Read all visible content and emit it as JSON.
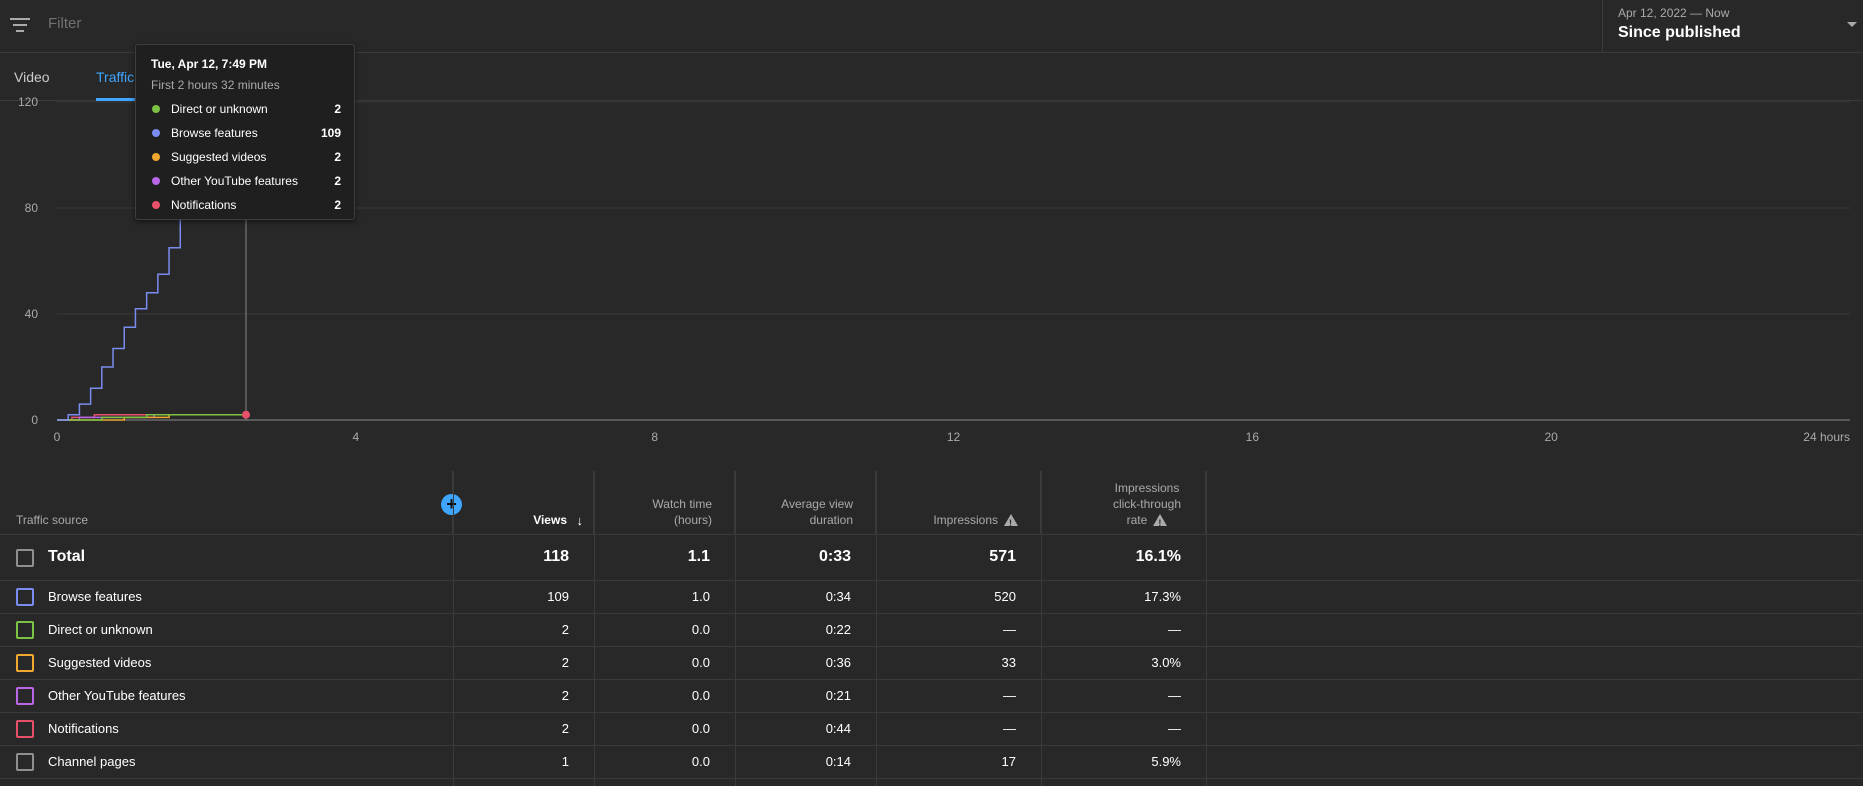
{
  "filter": {
    "placeholder": "Filter"
  },
  "date_picker": {
    "range": "Apr 12, 2022 — Now",
    "label": "Since published"
  },
  "tabs": [
    {
      "label": "Video",
      "active": false
    },
    {
      "label": "Traffic source",
      "active": true
    }
  ],
  "tooltip": {
    "title": "Tue, Apr 12, 7:49 PM",
    "subtitle": "First 2 hours 32 minutes",
    "rows": [
      {
        "label": "Direct or unknown",
        "value": "2",
        "color": "#7cc244"
      },
      {
        "label": "Browse features",
        "value": "109",
        "color": "#7a8cf0"
      },
      {
        "label": "Suggested videos",
        "value": "2",
        "color": "#f0a830"
      },
      {
        "label": "Other YouTube features",
        "value": "2",
        "color": "#b967e8"
      },
      {
        "label": "Notifications",
        "value": "2",
        "color": "#e8506a"
      }
    ]
  },
  "chart_data": {
    "type": "line",
    "title": "",
    "xlabel": "",
    "ylabel": "",
    "x_unit": "hours",
    "x_tick_labels": [
      "0",
      "4",
      "8",
      "12",
      "16",
      "20",
      "24 hours"
    ],
    "x_ticks": [
      0,
      4,
      8,
      12,
      16,
      20,
      24
    ],
    "xlim": [
      0,
      24
    ],
    "y_ticks": [
      0,
      40,
      80,
      120
    ],
    "y_tick_labels": [
      "0",
      "40",
      "80",
      "120"
    ],
    "ylim": [
      0,
      120
    ],
    "grid": true,
    "cursor_x": 2.53,
    "series": [
      {
        "name": "Browse features",
        "color": "#7a8cf0",
        "x": [
          0,
          0.15,
          0.3,
          0.45,
          0.6,
          0.75,
          0.9,
          1.05,
          1.2,
          1.35,
          1.5,
          1.65,
          1.8,
          1.95
        ],
        "y": [
          0,
          2,
          6,
          12,
          20,
          27,
          35,
          42,
          48,
          55,
          65,
          77,
          90,
          109
        ]
      },
      {
        "name": "Direct or unknown",
        "color": "#7cc244",
        "x": [
          0,
          0.6,
          1.2,
          2.53
        ],
        "y": [
          0,
          1,
          2,
          2
        ]
      },
      {
        "name": "Suggested videos",
        "color": "#f0a830",
        "x": [
          0,
          0.9,
          1.5,
          2.53
        ],
        "y": [
          0,
          1,
          2,
          2
        ]
      },
      {
        "name": "Other YouTube features",
        "color": "#b967e8",
        "x": [
          0,
          0.3,
          1.3,
          2.53
        ],
        "y": [
          0,
          1,
          2,
          2
        ]
      },
      {
        "name": "Notifications",
        "color": "#e8506a",
        "x": [
          0,
          0.2,
          0.5,
          2.53
        ],
        "y": [
          0,
          1,
          2,
          2
        ]
      }
    ]
  },
  "table": {
    "headers": {
      "source": "Traffic source",
      "views": "Views",
      "watch_time_1": "Watch time",
      "watch_time_2": "(hours)",
      "avd_1": "Average view",
      "avd_2": "duration",
      "impressions": "Impressions",
      "ctr_1": "Impressions",
      "ctr_2": "click-through",
      "ctr_3": "rate"
    },
    "total": {
      "label": "Total",
      "views": "118",
      "watch": "1.1",
      "avd": "0:33",
      "impressions": "571",
      "ctr": "16.1%"
    },
    "rows": [
      {
        "label": "Browse features",
        "color": "#7a8cf0",
        "views": "109",
        "watch": "1.0",
        "avd": "0:34",
        "impressions": "520",
        "ctr": "17.3%"
      },
      {
        "label": "Direct or unknown",
        "color": "#7cc244",
        "views": "2",
        "watch": "0.0",
        "avd": "0:22",
        "impressions": "—",
        "ctr": "—"
      },
      {
        "label": "Suggested videos",
        "color": "#f0a830",
        "views": "2",
        "watch": "0.0",
        "avd": "0:36",
        "impressions": "33",
        "ctr": "3.0%"
      },
      {
        "label": "Other YouTube features",
        "color": "#b967e8",
        "views": "2",
        "watch": "0.0",
        "avd": "0:21",
        "impressions": "—",
        "ctr": "—"
      },
      {
        "label": "Notifications",
        "color": "#e8506a",
        "views": "2",
        "watch": "0.0",
        "avd": "0:44",
        "impressions": "—",
        "ctr": "—"
      },
      {
        "label": "Channel pages",
        "color": "#909090",
        "views": "1",
        "watch": "0.0",
        "avd": "0:14",
        "impressions": "17",
        "ctr": "5.9%"
      }
    ]
  }
}
